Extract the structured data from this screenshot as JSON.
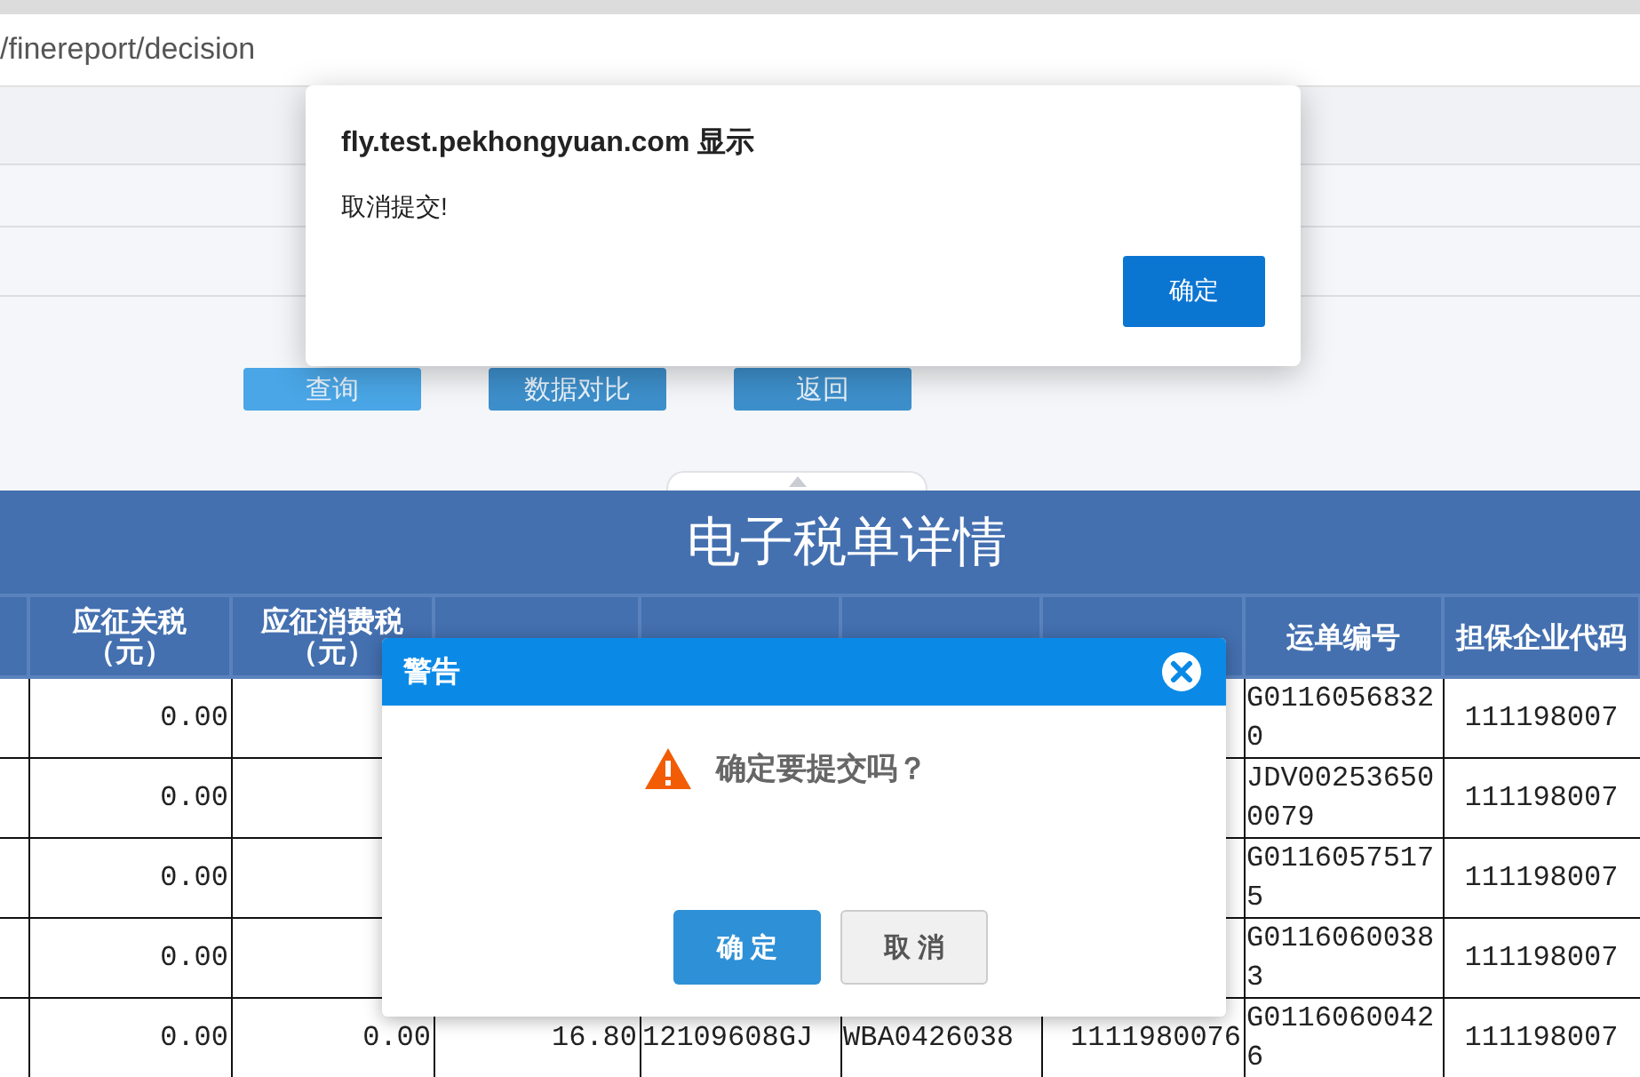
{
  "browser": {
    "address": "/finereport/decision"
  },
  "toolbar": {
    "buttons": [
      "查询",
      "数据对比",
      "返回"
    ]
  },
  "report": {
    "title": "电子税单详情",
    "columns": [
      "应征关税（元）",
      "应征消费税（元）",
      null,
      null,
      null,
      null,
      "运单编号",
      "担保企业代码"
    ],
    "rows": [
      {
        "cells": [
          "0.00",
          null,
          null,
          null,
          null,
          null,
          "G01160568320",
          "111198007"
        ]
      },
      {
        "cells": [
          "0.00",
          null,
          null,
          null,
          null,
          null,
          "JDV002536500079",
          "111198007"
        ]
      },
      {
        "cells": [
          "0.00",
          null,
          null,
          null,
          null,
          null,
          "G01160575175",
          "111198007"
        ]
      },
      {
        "cells": [
          "0.00",
          null,
          null,
          null,
          null,
          null,
          "G01160600383",
          "111198007"
        ]
      },
      {
        "cells": [
          "0.00",
          "0.00",
          "16.80",
          "12109608GJ",
          "WBA0426038",
          "1111980076",
          "G01160600426",
          "111198007"
        ]
      }
    ]
  },
  "alert": {
    "title": "fly.test.pekhongyuan.com 显示",
    "message": "取消提交!",
    "button": "确定"
  },
  "confirm": {
    "title": "警告",
    "message": "确定要提交吗？",
    "buttons": [
      {
        "label": "确 定",
        "kind": "primary"
      },
      {
        "label": "取 消",
        "kind": "secondary"
      }
    ]
  }
}
